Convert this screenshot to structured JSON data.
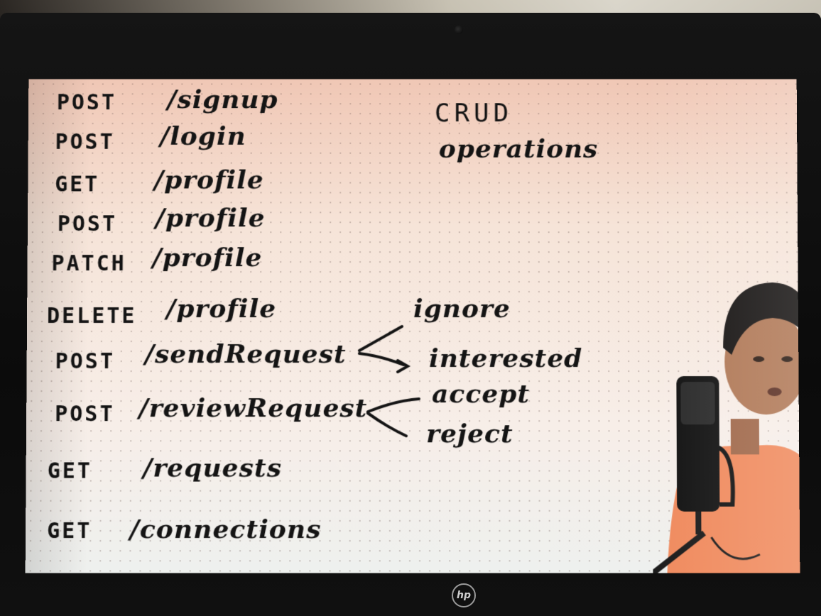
{
  "whiteboard": {
    "routes": [
      {
        "method": "POST",
        "path": "/signup"
      },
      {
        "method": "POST",
        "path": "/login"
      },
      {
        "method": "GET",
        "path": "/profile"
      },
      {
        "method": "POST",
        "path": "/profile"
      },
      {
        "method": "PATCH",
        "path": "/profile"
      },
      {
        "method": "DELETE",
        "path": "/profile"
      },
      {
        "method": "POST",
        "path": "/sendRequest"
      },
      {
        "method": "POST",
        "path": "/reviewRequest"
      },
      {
        "method": "GET",
        "path": "/requests"
      },
      {
        "method": "GET",
        "path": "/connections"
      }
    ],
    "crud_title": "CRUD",
    "crud_subtitle": "operations",
    "send_request_options": [
      "ignore",
      "interested"
    ],
    "review_request_options": [
      "accept",
      "reject"
    ]
  },
  "device": {
    "logo": "hp"
  },
  "colors": {
    "ink": "#141414",
    "screen_bg": "#f7ebe3",
    "shirt": "#f08a5d"
  }
}
